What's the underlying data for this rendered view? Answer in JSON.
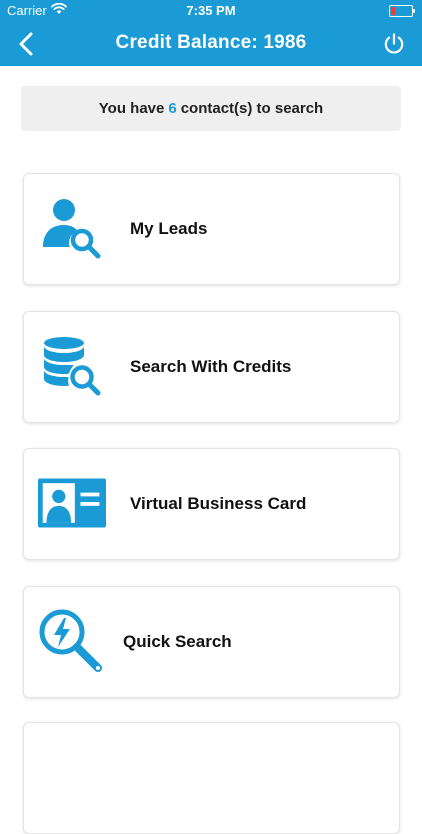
{
  "status_bar": {
    "carrier": "Carrier",
    "time": "7:35 PM"
  },
  "nav": {
    "title": "Credit Balance: 1986"
  },
  "banner": {
    "prefix": "You have",
    "count": "6",
    "suffix": "contact(s) to search"
  },
  "menu": {
    "items": [
      {
        "label": "My Leads",
        "icon": "user-search-icon"
      },
      {
        "label": "Search With Credits",
        "icon": "database-search-icon"
      },
      {
        "label": "Virtual Business Card",
        "icon": "id-card-icon"
      },
      {
        "label": "Quick Search",
        "icon": "quick-search-icon"
      }
    ]
  },
  "colors": {
    "accent": "#1a9bd5",
    "banner_bg": "#efefef",
    "battery_low": "#ff3b30"
  }
}
